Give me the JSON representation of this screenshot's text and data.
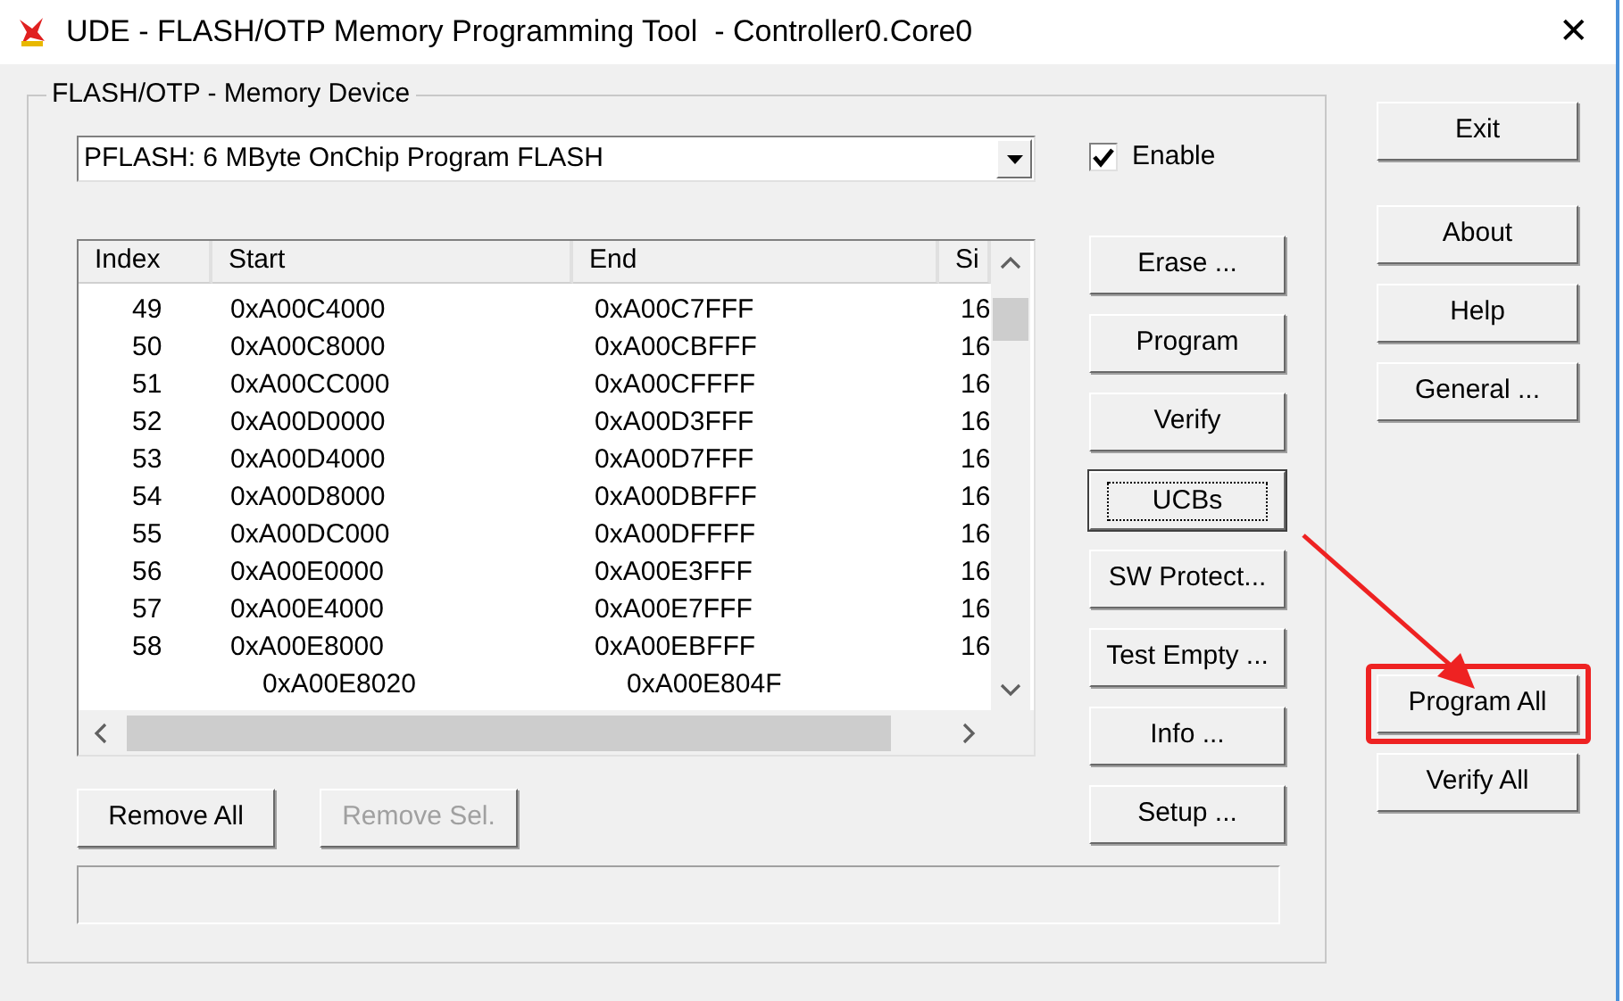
{
  "window": {
    "title": "UDE - FLASH/OTP Memory Programming Tool  - Controller0.Core0",
    "close": "✕"
  },
  "group": {
    "title": "FLASH/OTP - Memory Device",
    "device": {
      "value": "PFLASH: 6 MByte OnChip Program FLASH"
    },
    "enable": {
      "label": "Enable",
      "checked": true
    },
    "table": {
      "columns": [
        "Index",
        "Start",
        "End",
        "Si"
      ],
      "rows": [
        {
          "index": "49",
          "start": "0xA00C4000",
          "end": "0xA00C7FFF",
          "size": "16"
        },
        {
          "index": "50",
          "start": "0xA00C8000",
          "end": "0xA00CBFFF",
          "size": "16"
        },
        {
          "index": "51",
          "start": "0xA00CC000",
          "end": "0xA00CFFFF",
          "size": "16"
        },
        {
          "index": "52",
          "start": "0xA00D0000",
          "end": "0xA00D3FFF",
          "size": "16"
        },
        {
          "index": "53",
          "start": "0xA00D4000",
          "end": "0xA00D7FFF",
          "size": "16"
        },
        {
          "index": "54",
          "start": "0xA00D8000",
          "end": "0xA00DBFFF",
          "size": "16"
        },
        {
          "index": "55",
          "start": "0xA00DC000",
          "end": "0xA00DFFFF",
          "size": "16"
        },
        {
          "index": "56",
          "start": "0xA00E0000",
          "end": "0xA00E3FFF",
          "size": "16"
        },
        {
          "index": "57",
          "start": "0xA00E4000",
          "end": "0xA00E7FFF",
          "size": "16"
        },
        {
          "index": "58",
          "start": "0xA00E8000",
          "end": "0xA00EBFFF",
          "size": "16",
          "children": [
            {
              "start": "0xA00E8020",
              "end": "0xA00E804F"
            }
          ]
        }
      ]
    },
    "progress": {
      "level": 0
    },
    "list_buttons": [
      {
        "label": "Remove All",
        "disabled": false
      },
      {
        "label": "Remove Sel.",
        "disabled": true
      }
    ],
    "action_buttons": [
      {
        "label": "Erase ...",
        "focused": false
      },
      {
        "label": "Program",
        "focused": false
      },
      {
        "label": "Verify",
        "focused": false
      },
      {
        "label": "UCBs",
        "focused": true
      },
      {
        "label": "SW Protect...",
        "focused": false
      },
      {
        "label": "Test Empty ...",
        "focused": false
      },
      {
        "label": "Info ...",
        "focused": false
      },
      {
        "label": "Setup ...",
        "focused": false
      }
    ]
  },
  "side_buttons": [
    {
      "label": "Exit",
      "highlighted": false
    },
    {
      "label": "About",
      "highlighted": false
    },
    {
      "label": "Help",
      "highlighted": false
    },
    {
      "label": "General ...",
      "highlighted": false
    },
    {
      "label": "Program All",
      "highlighted": true
    },
    {
      "label": "Verify All",
      "highlighted": false
    }
  ]
}
